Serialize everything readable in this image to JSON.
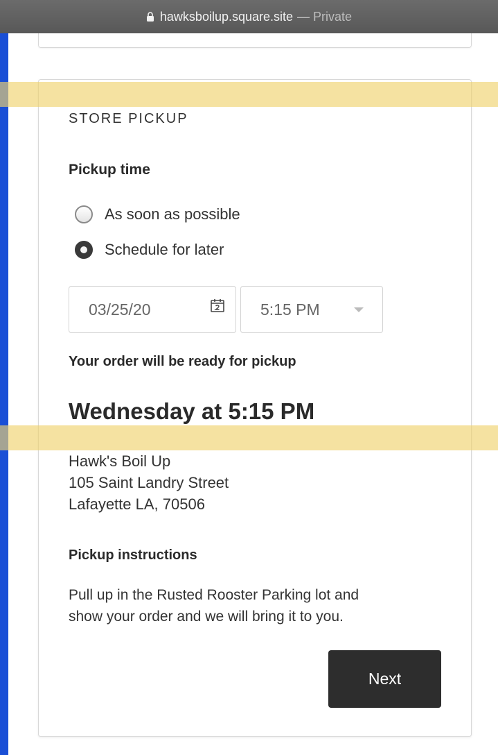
{
  "browser": {
    "domain": "hawksboilup.square.site",
    "separator": "—",
    "mode": "Private"
  },
  "pickup": {
    "section_title": "STORE PICKUP",
    "time_label": "Pickup time",
    "options": [
      {
        "label": "As soon as possible",
        "selected": false
      },
      {
        "label": "Schedule for later",
        "selected": true
      }
    ],
    "date_value": "03/25/20",
    "time_value": "5:15 PM",
    "ready_text": "Your order will be ready for pickup",
    "ready_time": "Wednesday at 5:15 PM",
    "store": {
      "name": "Hawk's Boil Up",
      "street": "105 Saint Landry Street",
      "city": "Lafayette LA, 70506"
    },
    "instructions_label": "Pickup instructions",
    "instructions_line1": "Pull up in the Rusted Rooster Parking lot and",
    "instructions_line2": "show your order and we will bring it to you.",
    "next_label": "Next"
  },
  "icons": {
    "lock": "lock-icon",
    "calendar": "calendar-icon",
    "dropdown": "chevron-down-icon"
  },
  "colors": {
    "button": "#2d2d2d",
    "highlight": "#f0d26e",
    "frame": "#1a4fd6"
  }
}
